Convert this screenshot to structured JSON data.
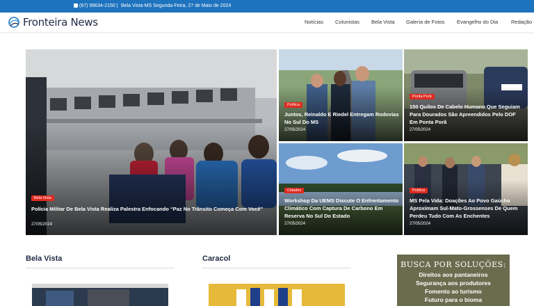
{
  "topbar": {
    "phone": "(67) 99634-2150 |",
    "location_date": "Bela Vista-MS Segunda-Feira, 27 de Maio de 2024"
  },
  "brand": {
    "name": "Fronteira News"
  },
  "nav": {
    "items": [
      "Notícias",
      "Colunistas",
      "Bela Vista",
      "Galeria de Fotos",
      "Evangelho do Dia",
      "Redação"
    ]
  },
  "featured": {
    "category": "Bela Vista",
    "headline": "Polícia Militar De Bela Vista Realiza Palestra Enfocando “Paz No Trânsito Começa Com Você”",
    "date": "27/05/2024"
  },
  "grid": [
    {
      "category": "Política",
      "headline": "Juntos, Reinaldo E Riedel Entregam Rodovias No Sul Do MS",
      "date": "27/05/2024"
    },
    {
      "category": "Ponta Porã",
      "headline": "150 Quilos De Cabelo Humano Que Seguiam Para Dourados São Apreendidos Pelo DOF Em Ponta Porã",
      "date": "27/05/2024"
    },
    {
      "category": "Cidades",
      "headline": "Workshop Da UEMS Discute O Enfrentamento Climático Com Captura De Carbono Em Reserva No Sul Do Estado",
      "date": "27/05/2024"
    },
    {
      "category": "Política",
      "headline": "MS Pela Vida: Doações Ao Povo Gaúcho Aproximam Sul-Mato-Grossenses De Quem Perdeu Tudo Com As Enchentes",
      "date": "27/05/2024"
    }
  ],
  "sections": [
    {
      "title": "Bela Vista"
    },
    {
      "title": "Caracol"
    }
  ],
  "ad": {
    "title": "BUSCA POR SOLUÇÕES:",
    "lines": [
      "Direitos aos pantaneiros",
      "Segurança aos produtores",
      "Fomento ao turismo",
      "Futuro para o bioma"
    ]
  },
  "colors": {
    "topbar": "#1e73be",
    "badge": "#e02b20",
    "heading": "#1f2a44"
  },
  "icons": {
    "phone": "phone-icon",
    "logo": "logo-swirl-icon"
  }
}
